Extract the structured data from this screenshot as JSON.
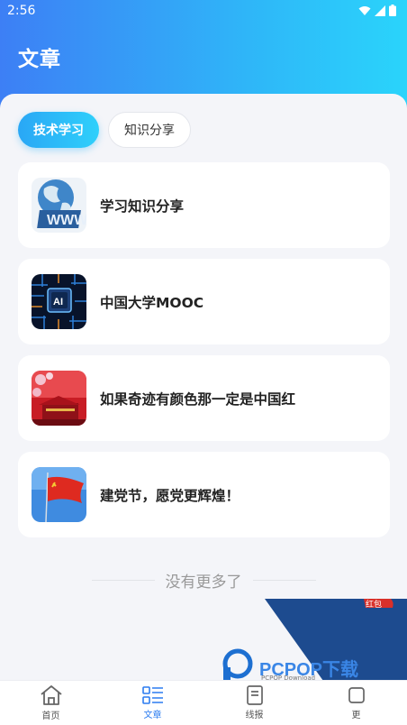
{
  "status_bar": {
    "time": "2:56"
  },
  "header": {
    "title": "文章"
  },
  "tabs": [
    {
      "label": "技术学习",
      "active": true
    },
    {
      "label": "知识分享",
      "active": false
    }
  ],
  "articles": [
    {
      "title": "学习知识分享",
      "thumb_icon": "www-globe-image"
    },
    {
      "title": "中国大学MOOC",
      "thumb_icon": "ai-chip-image"
    },
    {
      "title": "如果奇迹有颜色那一定是中国红",
      "thumb_icon": "tiananmen-image"
    },
    {
      "title": "建党节，愿党更辉煌！",
      "thumb_icon": "party-flag-image"
    }
  ],
  "list_end_text": "没有更多了",
  "bottom_nav": [
    {
      "label": "首页",
      "icon": "home-icon",
      "active": false
    },
    {
      "label": "文章",
      "icon": "article-list-icon",
      "active": true
    },
    {
      "label": "线报",
      "icon": "document-icon",
      "active": false
    },
    {
      "label": "更",
      "icon": "more-icon",
      "active": false
    }
  ],
  "watermark": {
    "brand": "PCPOP下载",
    "sub": "PCPOP Download",
    "badge": "红包"
  },
  "colors": {
    "accent": "#2b7cf0",
    "header_start": "#3d7ff5",
    "header_end": "#2ad4fb"
  }
}
